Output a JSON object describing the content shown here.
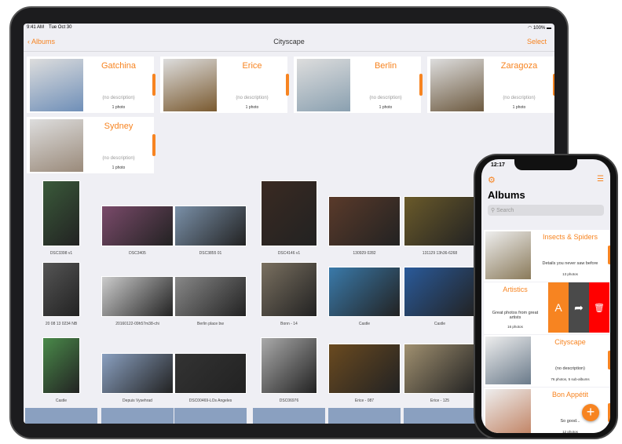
{
  "ipad": {
    "status": {
      "time": "9:41 AM",
      "date": "Tue Oct 30",
      "battery": "100%"
    },
    "nav": {
      "back": "Albums",
      "title": "Cityscape",
      "select": "Select"
    },
    "albums": [
      {
        "title": "Gatchina",
        "description": "(no description)",
        "count": "1 photo",
        "color": "#6f8fb8"
      },
      {
        "title": "Erice",
        "description": "(no description)",
        "count": "1 photo",
        "color": "#7a5a30"
      },
      {
        "title": "Berlin",
        "description": "(no description)",
        "count": "1 photo",
        "color": "#8aa0b0"
      },
      {
        "title": "Zaragoza",
        "description": "(no description)",
        "count": "1 photo",
        "color": "#6d5a40"
      },
      {
        "title": "Sydney",
        "description": "(no description)",
        "count": "1 photo",
        "color": "#9a8a7a"
      }
    ],
    "photos": [
      {
        "label": "DSC3398 v1",
        "color": "#3a5a3a"
      },
      {
        "label": "DSC3405",
        "color": "#7a4a6a"
      },
      {
        "label": "DSC3855 01",
        "color": "#7a90a8"
      },
      {
        "label": "DSC4146 v1",
        "color": "#3a2a22"
      },
      {
        "label": "130929 0282",
        "color": "#5a3a2a"
      },
      {
        "label": "131129 13h36-6268",
        "color": "#6a5a2a"
      },
      {
        "label": "20 08 13 0234 NB",
        "color": "#555"
      },
      {
        "label": "20160122-09h57m38-chi",
        "color": "#ccc"
      },
      {
        "label": "Berlin place bw",
        "color": "#888"
      },
      {
        "label": "Bonn - 14",
        "color": "#7a7060"
      },
      {
        "label": "Castle",
        "color": "#3a7aaa"
      },
      {
        "label": "Castle",
        "color": "#2a5a9a"
      },
      {
        "label": "Castle",
        "color": "#4a8a4a"
      },
      {
        "label": "Depuis Vysehrad",
        "color": "#8aa0c0"
      },
      {
        "label": "DSC00469-LOs Angeles",
        "color": "#333"
      },
      {
        "label": "DSC06976",
        "color": "#aaa"
      },
      {
        "label": "Erice - 087",
        "color": "#6a4a20"
      },
      {
        "label": "Erice - 125",
        "color": "#a09070"
      }
    ]
  },
  "iphone": {
    "time": "12:17",
    "title": "Albums",
    "search_placeholder": "Search",
    "albums": [
      {
        "title": "Insects & Spiders",
        "description": "Details you never saw before",
        "count": "13 photos",
        "color": "#8a7a5a"
      },
      {
        "title": "Artistics",
        "description": "Great photos from great artists",
        "count": "16 photos",
        "color": "#fff"
      },
      {
        "title": "Cityscape",
        "description": "(no description)",
        "count": "76 photos, 5 sub-albums",
        "color": "#6a7a8a"
      },
      {
        "title": "Bon Appétit",
        "description": "So good...",
        "count": "12 photos",
        "color": "#c08060"
      }
    ],
    "actions": {
      "rename": "A",
      "share": "➦",
      "delete": "🗑"
    },
    "colors": {
      "accent": "#f78421",
      "share": "#4a4a4a",
      "delete": "#ff0000"
    }
  }
}
